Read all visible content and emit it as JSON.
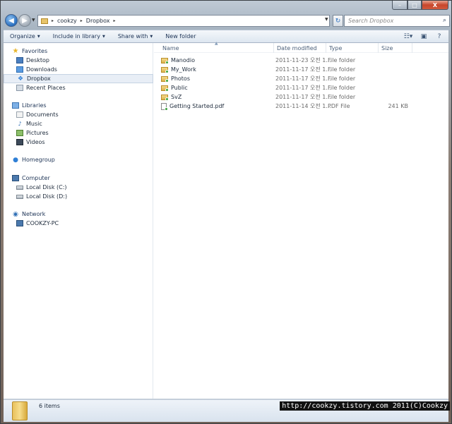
{
  "window": {
    "caption": {
      "minimize": "–",
      "maximize": "□",
      "close": "X"
    }
  },
  "address_bar": {
    "crumbs": [
      "cookzy",
      "Dropbox"
    ],
    "separator": "▸",
    "search_placeholder": "Search Dropbox"
  },
  "toolbar": {
    "organize": "Organize",
    "include_in_library": "Include in library",
    "share_with": "Share with",
    "new_folder": "New folder"
  },
  "sidebar": {
    "favorites": {
      "label": "Favorites",
      "items": [
        "Desktop",
        "Downloads",
        "Dropbox",
        "Recent Places"
      ],
      "selected": "Dropbox"
    },
    "libraries": {
      "label": "Libraries",
      "items": [
        "Documents",
        "Music",
        "Pictures",
        "Videos"
      ]
    },
    "homegroup": {
      "label": "Homegroup"
    },
    "computer": {
      "label": "Computer",
      "items": [
        "Local Disk (C:)",
        "Local Disk (D:)"
      ]
    },
    "network": {
      "label": "Network",
      "items": [
        "COOKZY-PC"
      ]
    }
  },
  "columns": {
    "name": "Name",
    "date_modified": "Date modified",
    "type": "Type",
    "size": "Size"
  },
  "files": [
    {
      "name": "Manodio",
      "date": "2011-11-23 오전 1...",
      "type": "File folder",
      "size": "",
      "kind": "folder"
    },
    {
      "name": "My_Work",
      "date": "2011-11-17 오전 1...",
      "type": "File folder",
      "size": "",
      "kind": "folder"
    },
    {
      "name": "Photos",
      "date": "2011-11-17 오전 1...",
      "type": "File folder",
      "size": "",
      "kind": "folder"
    },
    {
      "name": "Public",
      "date": "2011-11-17 오전 1...",
      "type": "File folder",
      "size": "",
      "kind": "folder"
    },
    {
      "name": "SvZ",
      "date": "2011-11-17 오전 1...",
      "type": "File folder",
      "size": "",
      "kind": "folder"
    },
    {
      "name": "Getting Started.pdf",
      "date": "2011-11-14 오전 1...",
      "type": "PDF File",
      "size": "241 KB",
      "kind": "pdf"
    }
  ],
  "status": {
    "item_count": "6 items"
  },
  "watermark": "http://cookzy.tistory.com 2011(C)Cookzy"
}
